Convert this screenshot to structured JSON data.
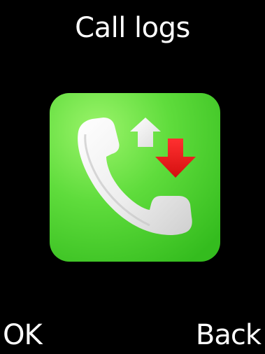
{
  "screen": {
    "title": "Call logs"
  },
  "app_icon": {
    "name": "call-logs-icon",
    "tile_color": "#5cd63a",
    "tile_color_light": "#8ff060",
    "tile_color_dark": "#33b81c",
    "handset_color": "#f2f2f2",
    "outgoing_arrow_color": "#ffffff",
    "incoming_arrow_color": "#ee1a1a"
  },
  "softkeys": {
    "left_label": "OK",
    "right_label": "Back"
  }
}
